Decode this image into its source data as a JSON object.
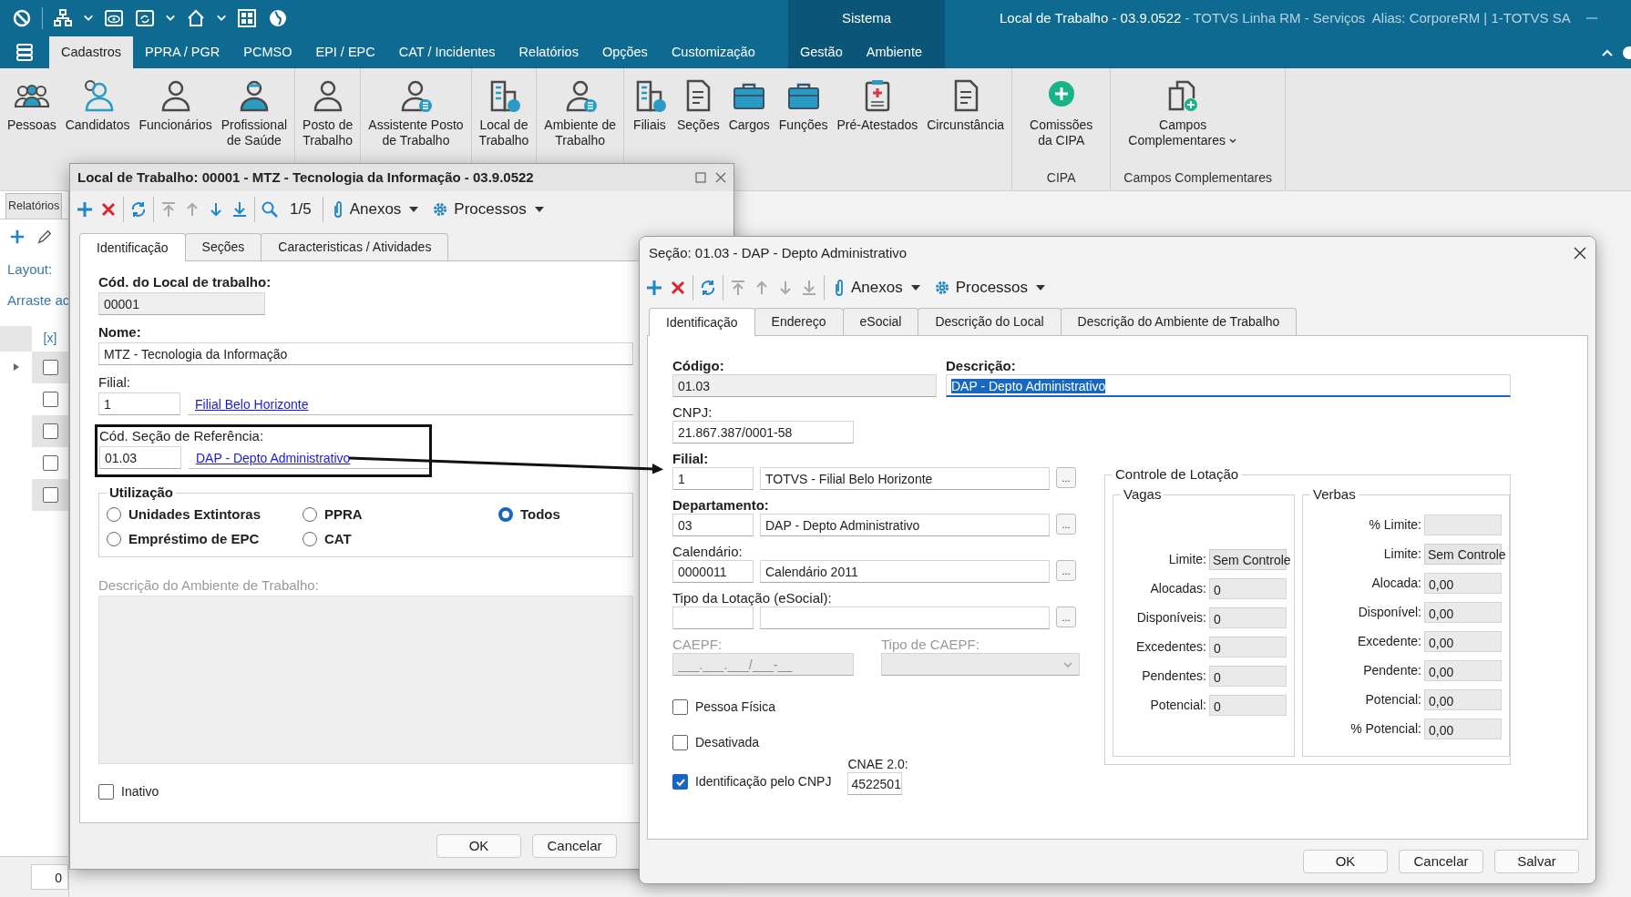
{
  "app_bar": {
    "system_label": "Sistema",
    "title": "Local de Trabalho - 03.9.0522",
    "subtitle": "- TOTVS Linha RM - Serviços  Alias: CorporeRM | 1-TOTVS SA"
  },
  "menu_tabs": [
    {
      "label": "Cadastros",
      "selected": true
    },
    {
      "label": "PPRA / PGR",
      "selected": false
    },
    {
      "label": "PCMSO",
      "selected": false
    },
    {
      "label": "EPI / EPC",
      "selected": false
    },
    {
      "label": "CAT / Incidentes",
      "selected": false
    },
    {
      "label": "Relatórios",
      "selected": false
    },
    {
      "label": "Opções",
      "selected": false
    },
    {
      "label": "Customização",
      "selected": false
    }
  ],
  "system_tabs": [
    {
      "label": "Gestão",
      "selected": false
    },
    {
      "label": "Ambiente",
      "selected": false
    }
  ],
  "ribbon": {
    "groups": [
      {
        "buttons": [
          {
            "label": "Pessoas"
          },
          {
            "label": "Candidatos"
          },
          {
            "label": "Funcionários"
          },
          {
            "label": "Profissional\nde Saúde"
          }
        ]
      },
      {
        "buttons": [
          {
            "label": "Posto de\nTrabalho"
          }
        ]
      },
      {
        "buttons": [
          {
            "label": "Assistente Posto\nde Trabalho"
          }
        ]
      },
      {
        "buttons": [
          {
            "label": "Local de\nTrabalho"
          }
        ]
      },
      {
        "buttons": [
          {
            "label": "Ambiente de\nTrabalho"
          }
        ]
      },
      {
        "buttons": [
          {
            "label": "Filiais"
          },
          {
            "label": "Seções"
          },
          {
            "label": "Cargos"
          },
          {
            "label": "Funções"
          },
          {
            "label": "Pré-Atestados"
          },
          {
            "label": "Circunstância"
          }
        ]
      },
      {
        "label": "CIPA",
        "buttons": [
          {
            "label": "Comissões\nda CIPA"
          }
        ]
      },
      {
        "label": "Campos Complementares",
        "buttons": [
          {
            "label": "Campos\nComplementares",
            "dropdown": true
          }
        ]
      }
    ]
  },
  "side_panel": {
    "tab": "Relatórios",
    "layout_label": "Layout:",
    "drag_hint": "Arraste ac",
    "grid_header": "[x]",
    "rows": [
      {
        "current": true,
        "checked": false
      },
      {
        "current": false,
        "checked": false
      },
      {
        "current": false,
        "checked": false
      },
      {
        "current": false,
        "checked": false
      },
      {
        "current": false,
        "checked": false
      }
    ],
    "footer_value": "0"
  },
  "main_window": {
    "title": "Local de Trabalho: 00001 - MTZ - Tecnologia da Informação - 03.9.0522",
    "toolbar": {
      "navigation": [
        {
          "enabled": false
        },
        {
          "enabled": false
        },
        {
          "enabled": true
        },
        {
          "enabled": true
        }
      ],
      "record": "1/5",
      "attachments": "Anexos",
      "processes": "Processos"
    },
    "tabs": [
      {
        "label": "Identificação",
        "selected": true
      },
      {
        "label": "Seções",
        "selected": false
      },
      {
        "label": "Caracteristicas / Atividades",
        "selected": false
      }
    ],
    "fields": [
      {
        "label": "Cód. do Local de trabalho:",
        "required": true,
        "value": "00001",
        "readonly": true,
        "kind": "short",
        "highlighted": false
      },
      {
        "label": "Nome:",
        "required": true,
        "value": "MTZ - Tecnologia da Informação",
        "readonly": false,
        "kind": "wide",
        "highlighted": false
      },
      {
        "label": "Filial:",
        "required": false,
        "value": "1",
        "link": "Filial Belo Horizonte",
        "readonly": false,
        "kind": "link",
        "highlighted": false
      },
      {
        "label": "Cód. Seção de Referência:",
        "required": false,
        "value": "01.03",
        "link": "DAP - Depto Administrativo",
        "readonly": false,
        "kind": "link",
        "highlighted": true
      }
    ],
    "usage": {
      "title": "Utilização",
      "options": [
        {
          "label": "Unidades Extintoras",
          "selected": false
        },
        {
          "label": "PPRA",
          "selected": false
        },
        {
          "label": "Todos",
          "selected": true
        },
        {
          "label": "Empréstimo de EPC",
          "selected": false
        },
        {
          "label": "CAT",
          "selected": false
        }
      ]
    },
    "description": {
      "label": "Descrição do Ambiente de Trabalho:",
      "disabled": true
    },
    "inactive": {
      "label": "Inativo",
      "checked": false
    },
    "buttons": [
      {
        "label": "OK"
      },
      {
        "label": "Cancelar"
      }
    ]
  },
  "section_dialog": {
    "title": "Seção: 01.03 - DAP - Depto Administrativo",
    "toolbar": {
      "navigation": [
        {
          "enabled": false
        },
        {
          "enabled": false
        },
        {
          "enabled": false
        },
        {
          "enabled": false
        }
      ],
      "attachments": "Anexos",
      "processes": "Processos"
    },
    "tabs": [
      {
        "label": "Identificação",
        "selected": true
      },
      {
        "label": "Endereço",
        "selected": false
      },
      {
        "label": "eSocial",
        "selected": false
      },
      {
        "label": "Descrição do Local",
        "selected": false
      },
      {
        "label": "Descrição do Ambiente de Trabalho",
        "selected": false
      }
    ],
    "code": {
      "label": "Código:",
      "required": true,
      "value": "01.03",
      "readonly": true
    },
    "description": {
      "label": "Descrição:",
      "required": true,
      "value": "DAP - Depto Administrativo",
      "focused": true
    },
    "cnpj": {
      "label": "CNPJ:",
      "required": false,
      "value": "21.867.387/0001-58"
    },
    "lookups": [
      {
        "label": "Filial:",
        "required": true,
        "code": "1",
        "description": "TOTVS - Filial Belo Horizonte",
        "browse": "..."
      },
      {
        "label": "Departamento:",
        "required": true,
        "code": "03",
        "description": "DAP - Depto Administrativo",
        "browse": "..."
      },
      {
        "label": "Calendário:",
        "required": false,
        "code": "0000011",
        "description": "Calendário 2011",
        "browse": "..."
      },
      {
        "label": "Tipo da Lotação (eSocial):",
        "required": false,
        "browse": "..."
      }
    ],
    "caepf": {
      "label": "CAEPF:",
      "placeholder": "___.___.___/___-__",
      "disabled": true
    },
    "caepf_type": {
      "label": "Tipo de CAEPF:",
      "disabled": true
    },
    "checkboxes": [
      {
        "label": "Pessoa Física",
        "checked": false
      },
      {
        "label": "Desativada",
        "checked": false
      },
      {
        "label": "Identificação pelo CNPJ",
        "checked": true
      }
    ],
    "cnae": {
      "label": "CNAE 2.0:",
      "value": "4522501"
    },
    "allocation": {
      "title": "Controle de Lotação",
      "groups": [
        {
          "title": "Vagas",
          "rows": [
            {
              "label": "Limite:",
              "value": "Sem Controle",
              "kind": "button"
            },
            {
              "label": "Alocadas:",
              "value": "0",
              "kind": "field"
            },
            {
              "label": "Disponíveis:",
              "value": "0",
              "kind": "field"
            },
            {
              "label": "Excedentes:",
              "value": "0",
              "kind": "field"
            },
            {
              "label": "Pendentes:",
              "value": "0",
              "kind": "field"
            },
            {
              "label": "Potencial:",
              "value": "0",
              "kind": "field"
            }
          ]
        },
        {
          "title": "Verbas",
          "rows": [
            {
              "label": "% Limite:",
              "kind": "field"
            },
            {
              "label": "Limite:",
              "value": "Sem Controle",
              "kind": "button"
            },
            {
              "label": "Alocada:",
              "value": "0,00",
              "kind": "field"
            },
            {
              "label": "Disponível:",
              "value": "0,00",
              "kind": "field"
            },
            {
              "label": "Excedente:",
              "value": "0,00",
              "kind": "field"
            },
            {
              "label": "Pendente:",
              "value": "0,00",
              "kind": "field"
            },
            {
              "label": "Potencial:",
              "value": "0,00",
              "kind": "field"
            },
            {
              "label": "% Potencial:",
              "value": "0,00",
              "kind": "field"
            }
          ]
        }
      ]
    },
    "buttons": [
      {
        "label": "OK"
      },
      {
        "label": "Cancelar"
      },
      {
        "label": "Salvar"
      }
    ]
  }
}
